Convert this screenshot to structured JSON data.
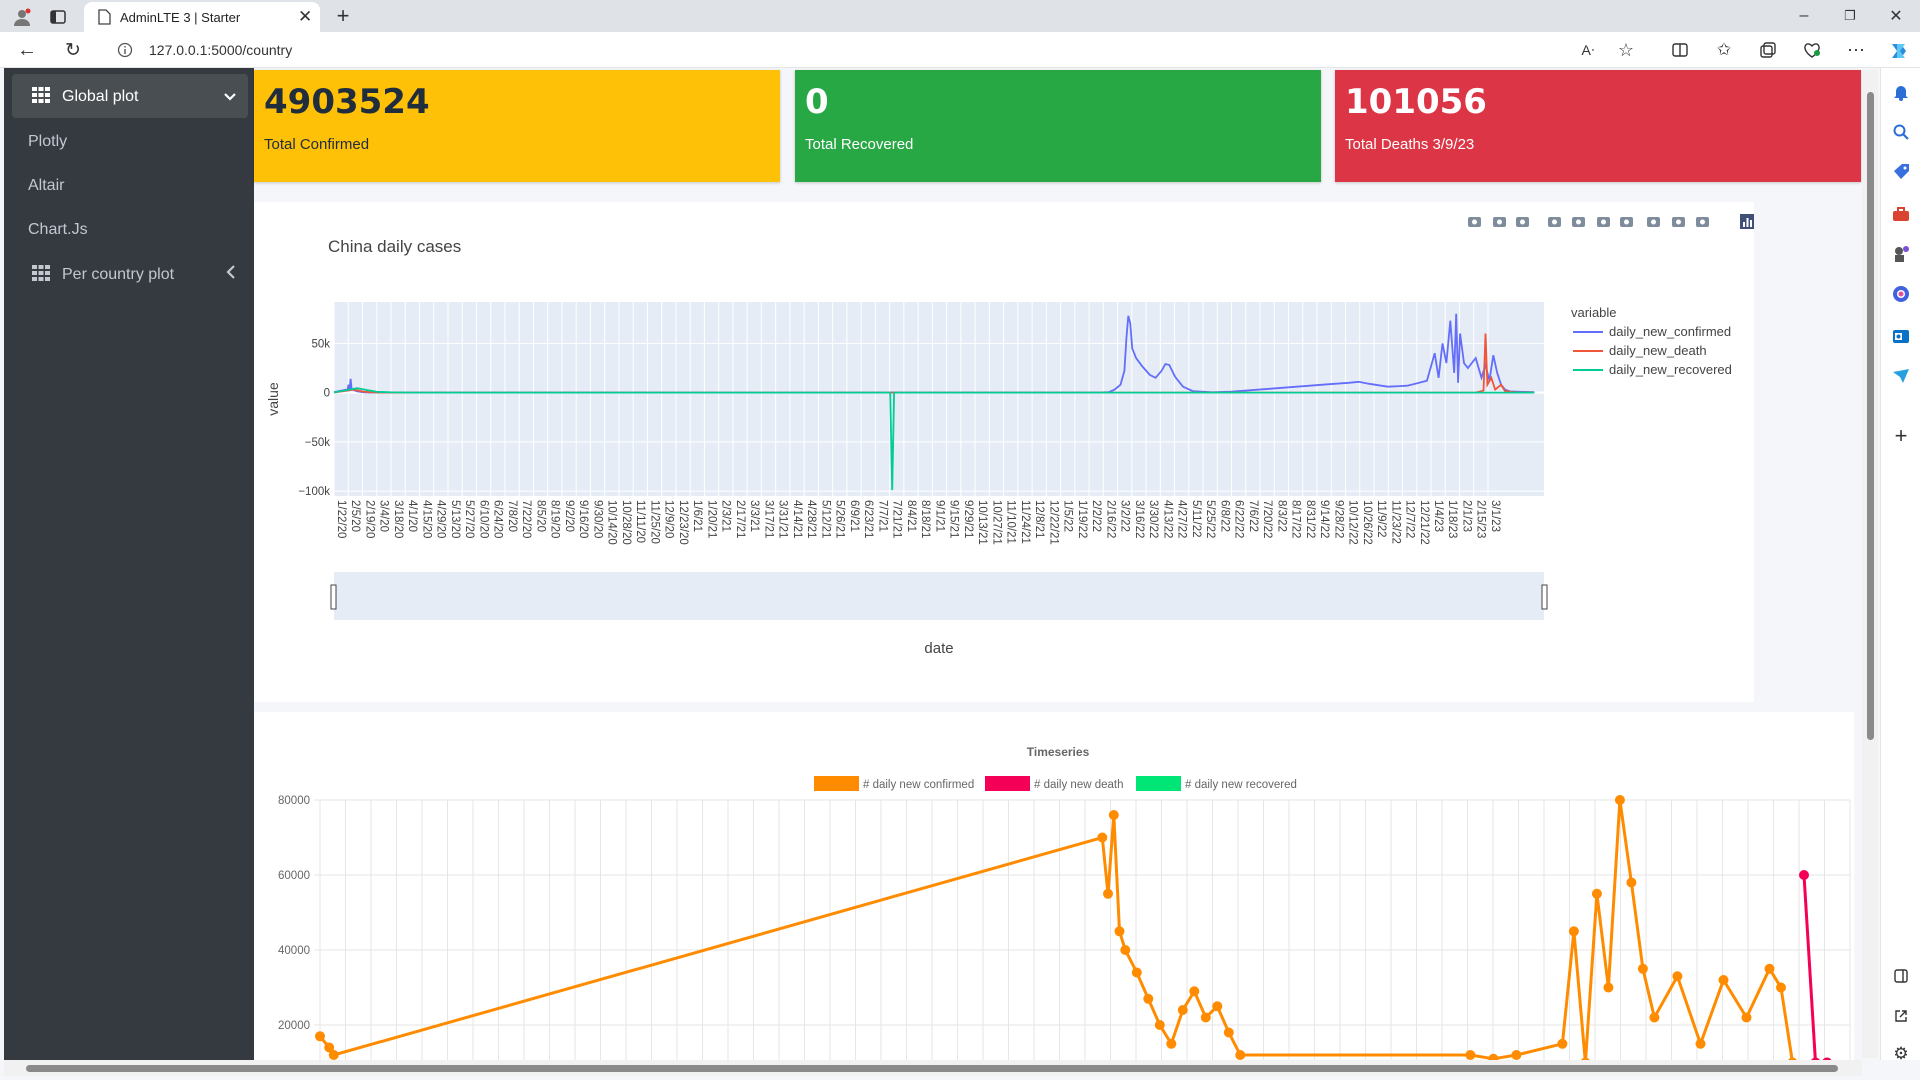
{
  "browser": {
    "tab_title": "AdminLTE 3 | Starter",
    "url": "127.0.0.1:5000/country"
  },
  "sidebar": {
    "items": [
      {
        "label": "Global plot",
        "icon": "grid-icon",
        "toggle": "chevron-down-icon",
        "active": true
      },
      {
        "label": "Plotly"
      },
      {
        "label": "Altair"
      },
      {
        "label": "Chart.Js"
      },
      {
        "label": "Per country plot",
        "icon": "grid-icon",
        "toggle": "chevron-left-icon"
      }
    ]
  },
  "cards": [
    {
      "value": "4903524",
      "label": "Total Confirmed",
      "color": "#ffc107",
      "text": "#1f2d3d"
    },
    {
      "value": "0",
      "label": "Total Recovered",
      "color": "#28a745",
      "text": "#ffffff"
    },
    {
      "value": "101056",
      "label": "Total Deaths 3/9/23",
      "color": "#dc3545",
      "text": "#ffffff"
    }
  ],
  "plotly": {
    "toolbar_icons": [
      "camera-icon",
      "zoom-icon",
      "pan-icon",
      "zoom-in-icon",
      "zoom-out-icon",
      "autoscale-icon",
      "reset-axes-icon",
      "spike-lines-icon",
      "hover-closest-icon",
      "hover-compare-icon",
      "plotly-logo-icon"
    ]
  },
  "chart_data": [
    {
      "type": "line",
      "title": "China daily  cases",
      "xlabel": "date",
      "ylabel": "value",
      "ylim": [
        -105000,
        92000
      ],
      "grid": true,
      "legend_title": "variable",
      "legend_position": "right",
      "y_ticks": [
        "50k",
        "0",
        "−50k",
        "−100k"
      ],
      "x_ticks": [
        "1/22/20",
        "2/5/20",
        "2/19/20",
        "3/4/20",
        "3/18/20",
        "4/1/20",
        "4/15/20",
        "4/29/20",
        "5/13/20",
        "5/27/20",
        "6/10/20",
        "6/24/20",
        "7/8/20",
        "7/22/20",
        "8/5/20",
        "8/19/20",
        "9/2/20",
        "9/16/20",
        "9/30/20",
        "10/14/20",
        "10/28/20",
        "11/11/20",
        "11/25/20",
        "12/9/20",
        "12/23/20",
        "1/6/21",
        "1/20/21",
        "2/3/21",
        "2/17/21",
        "3/3/21",
        "3/17/21",
        "3/31/21",
        "4/14/21",
        "4/28/21",
        "5/12/21",
        "5/26/21",
        "6/9/21",
        "6/23/21",
        "7/7/21",
        "7/21/21",
        "8/4/21",
        "8/18/21",
        "9/1/21",
        "9/15/21",
        "9/29/21",
        "10/13/21",
        "10/27/21",
        "11/10/21",
        "11/24/21",
        "12/8/21",
        "12/22/21",
        "1/5/22",
        "1/19/22",
        "2/2/22",
        "2/16/22",
        "3/2/22",
        "3/16/22",
        "3/30/22",
        "4/13/22",
        "4/27/22",
        "5/11/22",
        "5/25/22",
        "6/8/22",
        "6/22/22",
        "7/6/22",
        "7/20/22",
        "8/3/22",
        "8/17/22",
        "8/31/22",
        "9/14/22",
        "9/28/22",
        "10/12/22",
        "10/26/22",
        "11/9/22",
        "11/23/22",
        "12/7/22",
        "12/21/22",
        "1/4/23",
        "1/18/23",
        "2/1/23",
        "2/15/23",
        "3/1/23"
      ],
      "series": [
        {
          "name": "daily_new_confirmed",
          "color": "#636efa",
          "points": [
            [
              0,
              500
            ],
            [
              10,
              2500
            ],
            [
              14,
              3500
            ],
            [
              15,
              8000
            ],
            [
              16,
              2000
            ],
            [
              17,
              14000
            ],
            [
              18,
              3800
            ],
            [
              20,
              2500
            ],
            [
              24,
              1200
            ],
            [
              30,
              400
            ],
            [
              36,
              100
            ],
            [
              60,
              50
            ],
            [
              400,
              30
            ],
            [
              784,
              60
            ],
            [
              794,
              400
            ],
            [
              800,
              3000
            ],
            [
              806,
              8000
            ],
            [
              810,
              22000
            ],
            [
              812,
              55000
            ],
            [
              814,
              78000
            ],
            [
              816,
              70000
            ],
            [
              818,
              45000
            ],
            [
              822,
              35000
            ],
            [
              828,
              27000
            ],
            [
              836,
              18000
            ],
            [
              842,
              15000
            ],
            [
              848,
              22000
            ],
            [
              852,
              29000
            ],
            [
              856,
              28000
            ],
            [
              862,
              16000
            ],
            [
              870,
              6000
            ],
            [
              880,
              1500
            ],
            [
              900,
              300
            ],
            [
              920,
              1000
            ],
            [
              960,
              4000
            ],
            [
              1000,
              7000
            ],
            [
              1020,
              8500
            ],
            [
              1040,
              10000
            ],
            [
              1050,
              11000
            ],
            [
              1060,
              9000
            ],
            [
              1080,
              6000
            ],
            [
              1100,
              7000
            ],
            [
              1120,
              12000
            ],
            [
              1128,
              40000
            ],
            [
              1132,
              15000
            ],
            [
              1136,
              50000
            ],
            [
              1140,
              30000
            ],
            [
              1144,
              73000
            ],
            [
              1148,
              20000
            ],
            [
              1150,
              80000
            ],
            [
              1152,
              10000
            ],
            [
              1154,
              60000
            ],
            [
              1158,
              30000
            ],
            [
              1162,
              25000
            ],
            [
              1170,
              35000
            ],
            [
              1176,
              15000
            ],
            [
              1180,
              28000
            ],
            [
              1184,
              12000
            ],
            [
              1188,
              38000
            ],
            [
              1192,
              20000
            ],
            [
              1196,
              8000
            ],
            [
              1200,
              3000
            ],
            [
              1205,
              1200
            ],
            [
              1215,
              800
            ],
            [
              1230,
              400
            ]
          ]
        },
        {
          "name": "daily_new_death",
          "color": "#ef553b",
          "points": [
            [
              0,
              50
            ],
            [
              14,
              2000
            ],
            [
              20,
              3000
            ],
            [
              30,
              1000
            ],
            [
              40,
              200
            ],
            [
              60,
              0
            ],
            [
              1170,
              0
            ],
            [
              1178,
              2000
            ],
            [
              1180,
              60000
            ],
            [
              1182,
              8000
            ],
            [
              1186,
              15000
            ],
            [
              1190,
              3000
            ],
            [
              1196,
              8000
            ],
            [
              1200,
              1500
            ],
            [
              1210,
              300
            ],
            [
              1230,
              0
            ]
          ]
        },
        {
          "name": "daily_new_recovered",
          "color": "#00cc96",
          "points": [
            [
              0,
              200
            ],
            [
              16,
              3000
            ],
            [
              24,
              4500
            ],
            [
              34,
              2500
            ],
            [
              44,
              800
            ],
            [
              60,
              200
            ],
            [
              80,
              0
            ],
            [
              570,
              0
            ],
            [
              572,
              -99000
            ],
            [
              574,
              0
            ],
            [
              1230,
              0
            ]
          ]
        }
      ]
    },
    {
      "type": "line",
      "title": "Timeseries",
      "xlabel": "",
      "ylabel": "",
      "ylim": [
        0,
        80000
      ],
      "y_ticks": [
        "80000",
        "60000",
        "40000",
        "20000"
      ],
      "grid": true,
      "legend_position": "top-center",
      "series": [
        {
          "name": "# daily new confirmed",
          "color": "#ff8c00",
          "points": [
            [
              0,
              17000
            ],
            [
              0.8,
              14000
            ],
            [
              1.2,
              12000
            ],
            [
              68,
              70000
            ],
            [
              68.5,
              55000
            ],
            [
              69,
              76000
            ],
            [
              69.5,
              45000
            ],
            [
              70,
              40000
            ],
            [
              71,
              34000
            ],
            [
              72,
              27000
            ],
            [
              73,
              20000
            ],
            [
              74,
              15000
            ],
            [
              75,
              24000
            ],
            [
              76,
              29000
            ],
            [
              77,
              22000
            ],
            [
              78,
              25000
            ],
            [
              79,
              18000
            ],
            [
              80,
              12000
            ],
            [
              100,
              12000
            ],
            [
              102,
              11000
            ],
            [
              104,
              12000
            ],
            [
              108,
              15000
            ],
            [
              109,
              45000
            ],
            [
              110,
              10000
            ],
            [
              111,
              55000
            ],
            [
              112,
              30000
            ],
            [
              113,
              80000
            ],
            [
              114,
              58000
            ],
            [
              115,
              35000
            ],
            [
              116,
              22000
            ],
            [
              118,
              33000
            ],
            [
              120,
              15000
            ],
            [
              122,
              32000
            ],
            [
              124,
              22000
            ],
            [
              126,
              35000
            ],
            [
              127,
              30000
            ],
            [
              128,
              10000
            ],
            [
              131,
              10000
            ]
          ]
        },
        {
          "name": "# daily new death",
          "color": "#f50057",
          "points": [
            [
              129,
              60000
            ],
            [
              130,
              10000
            ],
            [
              131,
              10000
            ]
          ]
        },
        {
          "name": "# daily new recovered",
          "color": "#00e676",
          "points": []
        }
      ]
    }
  ]
}
